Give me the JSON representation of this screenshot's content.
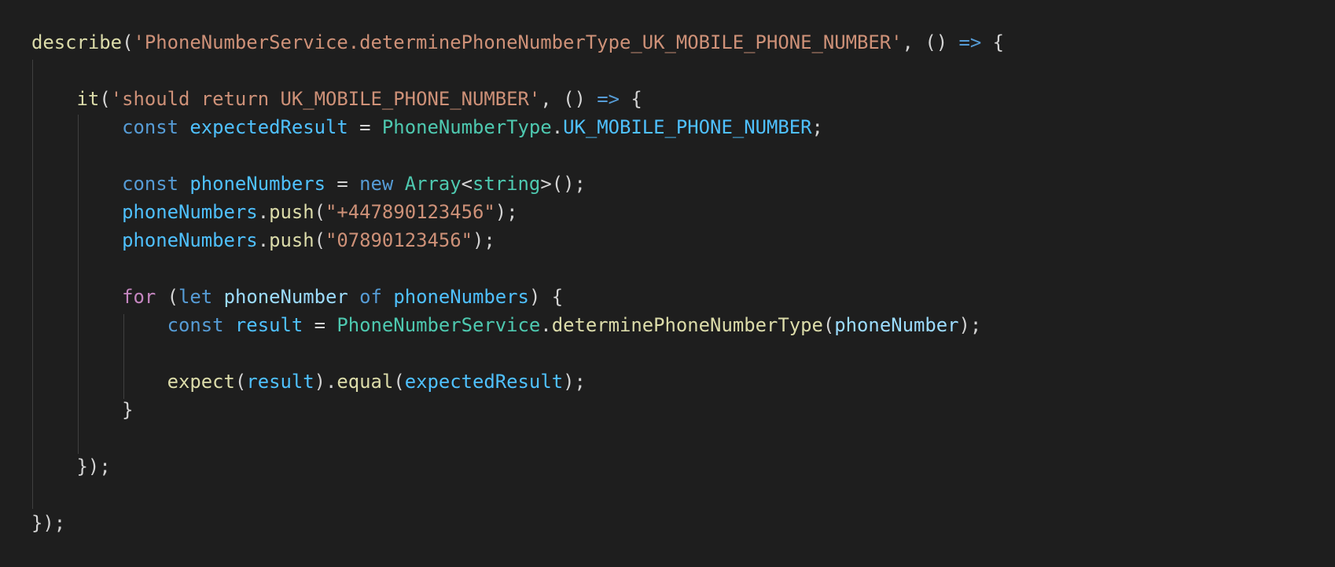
{
  "editor": {
    "background": "#1e1e1e",
    "colors": {
      "function": "#dcdcaa",
      "string": "#ce9178",
      "keyword": "#569cd6",
      "control": "#c586c0",
      "variable": "#9cdcfe",
      "constant": "#4fc1ff",
      "type": "#4ec9b0",
      "default": "#d4d4d4"
    }
  },
  "code": {
    "lines": [
      {
        "indent": "",
        "tokens": [
          {
            "t": "fn",
            "v": "describe"
          },
          {
            "t": "pun",
            "v": "("
          },
          {
            "t": "str",
            "v": "'PhoneNumberService.determinePhoneNumberType_UK_MOBILE_PHONE_NUMBER'"
          },
          {
            "t": "pun",
            "v": ", () "
          },
          {
            "t": "kw",
            "v": "=>"
          },
          {
            "t": "pun",
            "v": " {"
          }
        ]
      },
      {
        "indent": "",
        "tokens": []
      },
      {
        "indent": "    ",
        "tokens": [
          {
            "t": "fn",
            "v": "it"
          },
          {
            "t": "pun",
            "v": "("
          },
          {
            "t": "str",
            "v": "'should return UK_MOBILE_PHONE_NUMBER'"
          },
          {
            "t": "pun",
            "v": ", () "
          },
          {
            "t": "kw",
            "v": "=>"
          },
          {
            "t": "pun",
            "v": " {"
          }
        ]
      },
      {
        "indent": "        ",
        "tokens": [
          {
            "t": "kw",
            "v": "const"
          },
          {
            "t": "pun",
            "v": " "
          },
          {
            "t": "cst",
            "v": "expectedResult"
          },
          {
            "t": "pun",
            "v": " = "
          },
          {
            "t": "typ",
            "v": "PhoneNumberType"
          },
          {
            "t": "pun",
            "v": "."
          },
          {
            "t": "cst",
            "v": "UK_MOBILE_PHONE_NUMBER"
          },
          {
            "t": "pun",
            "v": ";"
          }
        ]
      },
      {
        "indent": "",
        "tokens": []
      },
      {
        "indent": "        ",
        "tokens": [
          {
            "t": "kw",
            "v": "const"
          },
          {
            "t": "pun",
            "v": " "
          },
          {
            "t": "cst",
            "v": "phoneNumbers"
          },
          {
            "t": "pun",
            "v": " = "
          },
          {
            "t": "kw",
            "v": "new"
          },
          {
            "t": "pun",
            "v": " "
          },
          {
            "t": "typ",
            "v": "Array"
          },
          {
            "t": "pun",
            "v": "<"
          },
          {
            "t": "typ",
            "v": "string"
          },
          {
            "t": "pun",
            "v": ">();"
          }
        ]
      },
      {
        "indent": "        ",
        "tokens": [
          {
            "t": "cst",
            "v": "phoneNumbers"
          },
          {
            "t": "pun",
            "v": "."
          },
          {
            "t": "fn",
            "v": "push"
          },
          {
            "t": "pun",
            "v": "("
          },
          {
            "t": "str",
            "v": "\"+447890123456\""
          },
          {
            "t": "pun",
            "v": ");"
          }
        ]
      },
      {
        "indent": "        ",
        "tokens": [
          {
            "t": "cst",
            "v": "phoneNumbers"
          },
          {
            "t": "pun",
            "v": "."
          },
          {
            "t": "fn",
            "v": "push"
          },
          {
            "t": "pun",
            "v": "("
          },
          {
            "t": "str",
            "v": "\"07890123456\""
          },
          {
            "t": "pun",
            "v": ");"
          }
        ]
      },
      {
        "indent": "",
        "tokens": []
      },
      {
        "indent": "        ",
        "tokens": [
          {
            "t": "ctl",
            "v": "for"
          },
          {
            "t": "pun",
            "v": " ("
          },
          {
            "t": "kw",
            "v": "let"
          },
          {
            "t": "pun",
            "v": " "
          },
          {
            "t": "var",
            "v": "phoneNumber"
          },
          {
            "t": "pun",
            "v": " "
          },
          {
            "t": "kw",
            "v": "of"
          },
          {
            "t": "pun",
            "v": " "
          },
          {
            "t": "cst",
            "v": "phoneNumbers"
          },
          {
            "t": "pun",
            "v": ") {"
          }
        ]
      },
      {
        "indent": "            ",
        "tokens": [
          {
            "t": "kw",
            "v": "const"
          },
          {
            "t": "pun",
            "v": " "
          },
          {
            "t": "cst",
            "v": "result"
          },
          {
            "t": "pun",
            "v": " = "
          },
          {
            "t": "typ",
            "v": "PhoneNumberService"
          },
          {
            "t": "pun",
            "v": "."
          },
          {
            "t": "fn",
            "v": "determinePhoneNumberType"
          },
          {
            "t": "pun",
            "v": "("
          },
          {
            "t": "var",
            "v": "phoneNumber"
          },
          {
            "t": "pun",
            "v": ");"
          }
        ]
      },
      {
        "indent": "",
        "tokens": []
      },
      {
        "indent": "            ",
        "tokens": [
          {
            "t": "fn",
            "v": "expect"
          },
          {
            "t": "pun",
            "v": "("
          },
          {
            "t": "cst",
            "v": "result"
          },
          {
            "t": "pun",
            "v": ")."
          },
          {
            "t": "fn",
            "v": "equal"
          },
          {
            "t": "pun",
            "v": "("
          },
          {
            "t": "cst",
            "v": "expectedResult"
          },
          {
            "t": "pun",
            "v": ");"
          }
        ]
      },
      {
        "indent": "        ",
        "tokens": [
          {
            "t": "pun",
            "v": "}"
          }
        ]
      },
      {
        "indent": "",
        "tokens": []
      },
      {
        "indent": "    ",
        "tokens": [
          {
            "t": "pun",
            "v": "});"
          }
        ]
      },
      {
        "indent": "",
        "tokens": []
      },
      {
        "indent": "",
        "tokens": [
          {
            "t": "pun",
            "v": "});"
          }
        ]
      }
    ]
  }
}
